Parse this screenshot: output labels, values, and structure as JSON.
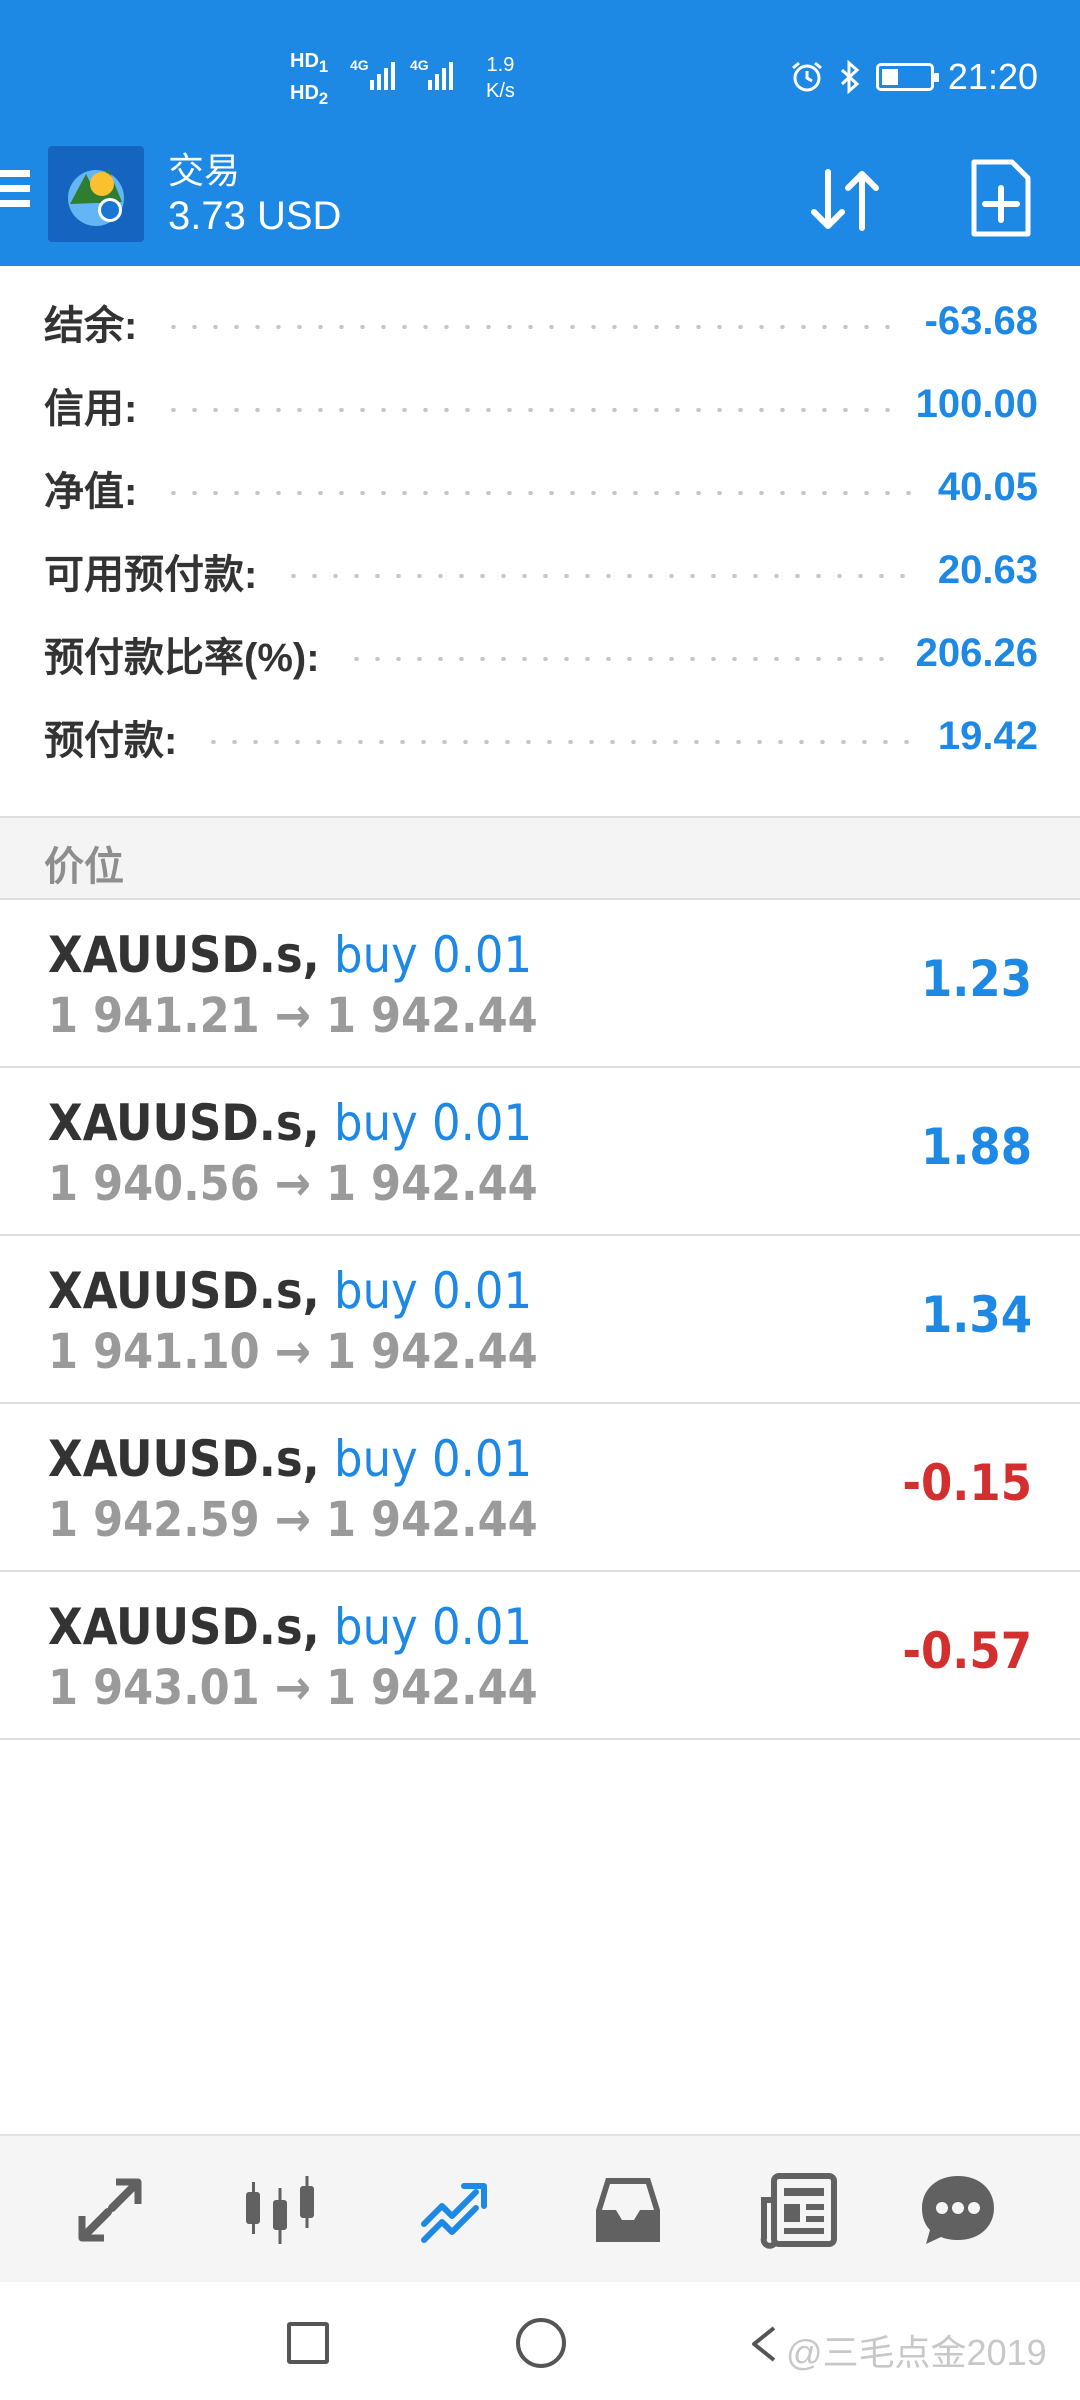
{
  "status_bar": {
    "hd1": "HD",
    "hd2": "HD",
    "sim1": "1",
    "sim2": "2",
    "net1": "4G",
    "net2": "4G",
    "speed_value": "1.9",
    "speed_unit": "K/s",
    "time": "21:20"
  },
  "app_bar": {
    "title": "交易",
    "subtitle": "3.73 USD"
  },
  "summary": [
    {
      "label": "结余:",
      "value": "-63.68"
    },
    {
      "label": "信用:",
      "value": "100.00"
    },
    {
      "label": "净值:",
      "value": "40.05"
    },
    {
      "label": "可用预付款:",
      "value": "20.63"
    },
    {
      "label": "预付款比率(%):",
      "value": "206.26"
    },
    {
      "label": "预付款:",
      "value": "19.42"
    }
  ],
  "section_title": "价位",
  "positions": [
    {
      "symbol": "XAUUSD.s,",
      "side": "buy 0.01",
      "prices": "1 941.21 → 1 942.44",
      "profit": "1.23"
    },
    {
      "symbol": "XAUUSD.s,",
      "side": "buy 0.01",
      "prices": "1 940.56 → 1 942.44",
      "profit": "1.88"
    },
    {
      "symbol": "XAUUSD.s,",
      "side": "buy 0.01",
      "prices": "1 941.10 → 1 942.44",
      "profit": "1.34"
    },
    {
      "symbol": "XAUUSD.s,",
      "side": "buy 0.01",
      "prices": "1 942.59 → 1 942.44",
      "profit": "-0.15"
    },
    {
      "symbol": "XAUUSD.s,",
      "side": "buy 0.01",
      "prices": "1 943.01 → 1 942.44",
      "profit": "-0.57"
    }
  ],
  "tabs": [
    {
      "icon": "quotes-icon",
      "active": false
    },
    {
      "icon": "chart-icon",
      "active": false
    },
    {
      "icon": "trade-icon",
      "active": true
    },
    {
      "icon": "history-icon",
      "active": false
    },
    {
      "icon": "news-icon",
      "active": false
    },
    {
      "icon": "messages-icon",
      "active": false
    }
  ],
  "watermark": "@三毛点金2019",
  "colors": {
    "header": "#1e88e5",
    "positive": "#1e88e5",
    "negative": "#d32f2f",
    "tab_active": "#1e88e5",
    "tab_inactive": "#616161"
  }
}
